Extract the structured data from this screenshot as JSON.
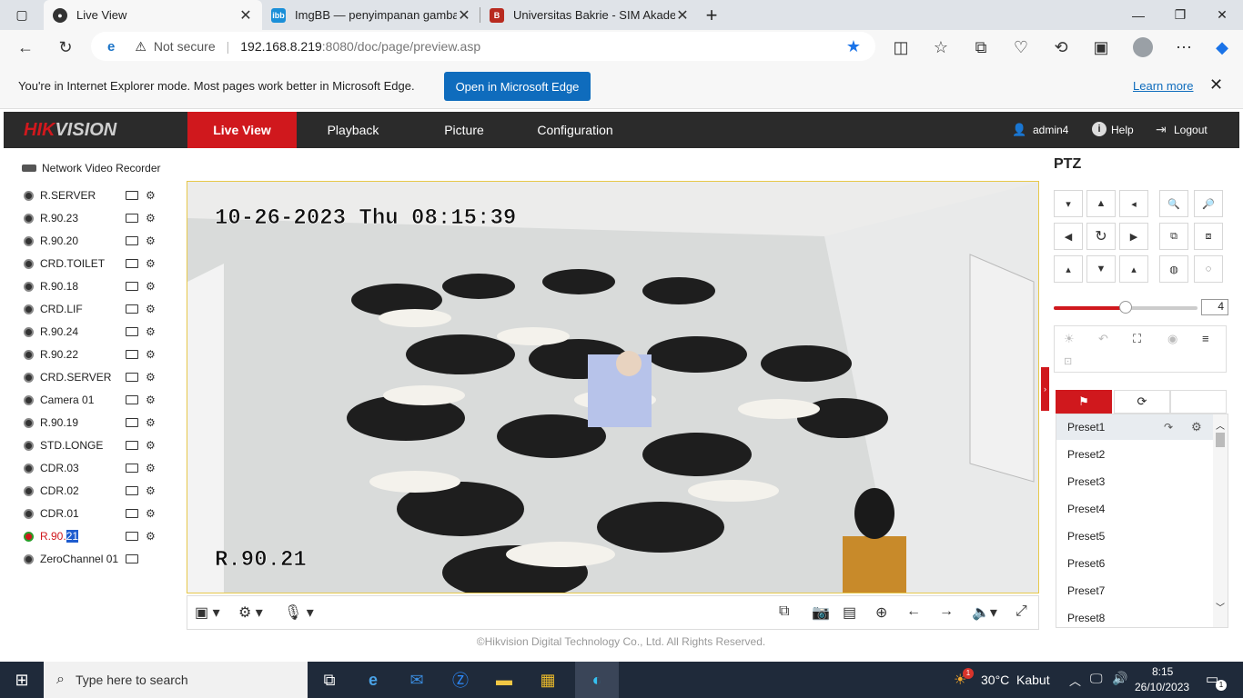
{
  "browser": {
    "tabs": [
      {
        "title": "Live View",
        "active": true,
        "favicon": "camera-icon"
      },
      {
        "title": "ImgBB — penyimpanan gambar",
        "favicon": "imgbb-icon",
        "favicon_text": "ibb"
      },
      {
        "title": "Universitas Bakrie - SIM Akademik",
        "favicon": "bakrie-icon"
      }
    ],
    "security": "Not secure",
    "url": "192.168.8.219",
    "url_rest": ":8080/doc/page/preview.asp",
    "ie_banner": {
      "text": "You're in Internet Explorer mode. Most pages work better in Microsoft Edge.",
      "button": "Open in Microsoft Edge",
      "link": "Learn more"
    }
  },
  "hik": {
    "logo": "HIKVISION",
    "nav": [
      "Live View",
      "Playback",
      "Picture",
      "Configuration"
    ],
    "active_nav": "Live View",
    "user": "admin4",
    "help": "Help",
    "logout": "Logout"
  },
  "tree": {
    "root": "Network Video Recorder",
    "devices": [
      {
        "label": "R.SERVER"
      },
      {
        "label": "R.90.23"
      },
      {
        "label": "R.90.20"
      },
      {
        "label": "CRD.TOILET"
      },
      {
        "label": "R.90.18"
      },
      {
        "label": "CRD.LIF"
      },
      {
        "label": "R.90.24"
      },
      {
        "label": "R.90.22"
      },
      {
        "label": "CRD.SERVER"
      },
      {
        "label": "Camera 01"
      },
      {
        "label": "R.90.19"
      },
      {
        "label": "STD.LONGE"
      },
      {
        "label": "CDR.03"
      },
      {
        "label": "CDR.02"
      },
      {
        "label": "CDR.01"
      },
      {
        "label": "R.90.",
        "label_hl": "21",
        "active": true
      },
      {
        "label": "ZeroChannel 01"
      }
    ]
  },
  "video": {
    "timestamp": "10-26-2023 Thu 08:15:39",
    "channel": "R.90.21"
  },
  "footer": "©Hikvision Digital Technology Co., Ltd. All Rights Reserved.",
  "ptz": {
    "title": "PTZ",
    "speed": "4",
    "speed_fraction": 0.5,
    "presets": [
      "Preset1",
      "Preset2",
      "Preset3",
      "Preset4",
      "Preset5",
      "Preset6",
      "Preset7",
      "Preset8"
    ]
  },
  "taskbar": {
    "search_placeholder": "Type here to search",
    "weather_temp": "30°C",
    "weather_desc": "Kabut",
    "weather_badge": "1",
    "time": "8:15",
    "date": "26/10/2023",
    "notif_count": "1"
  },
  "colors": {
    "hik_red": "#d0181d",
    "edge_blue": "#0f6cbd"
  }
}
